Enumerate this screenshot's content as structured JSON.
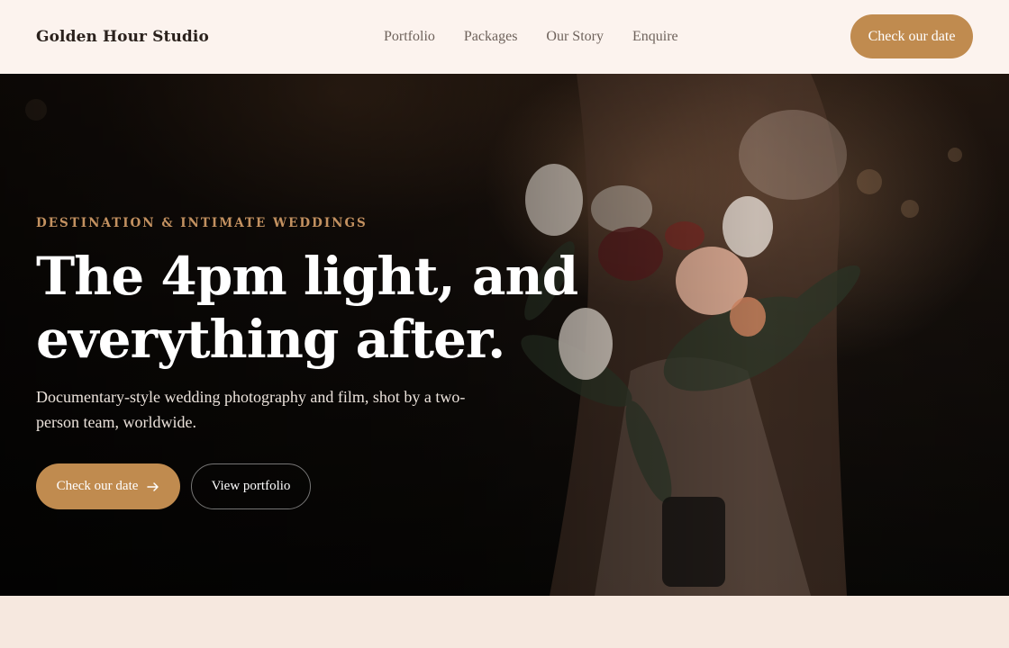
{
  "header": {
    "brand": "Golden Hour Studio",
    "nav": [
      {
        "label": "Portfolio"
      },
      {
        "label": "Packages"
      },
      {
        "label": "Our Story"
      },
      {
        "label": "Enquire"
      }
    ],
    "cta_label": "Check our date"
  },
  "hero": {
    "image_description": "bride holding bouquet",
    "eyebrow": "DESTINATION & INTIMATE WEDDINGS",
    "title_line1": "The 4pm light, and",
    "title_line2": "everything after.",
    "subtitle": "Documentary-style wedding photography and film, shot by a two-person team, worldwide.",
    "primary_button": {
      "label": "Check our date",
      "icon": "arrow-right-icon"
    },
    "secondary_button": {
      "label": "View portfolio"
    }
  },
  "colors": {
    "accent": "#c08b4f",
    "eyebrow": "#c39160",
    "header_bg": "#fcf3ee",
    "page_bg": "#f6e8df",
    "brand_text": "#2a211c",
    "nav_text": "#6e625b"
  }
}
